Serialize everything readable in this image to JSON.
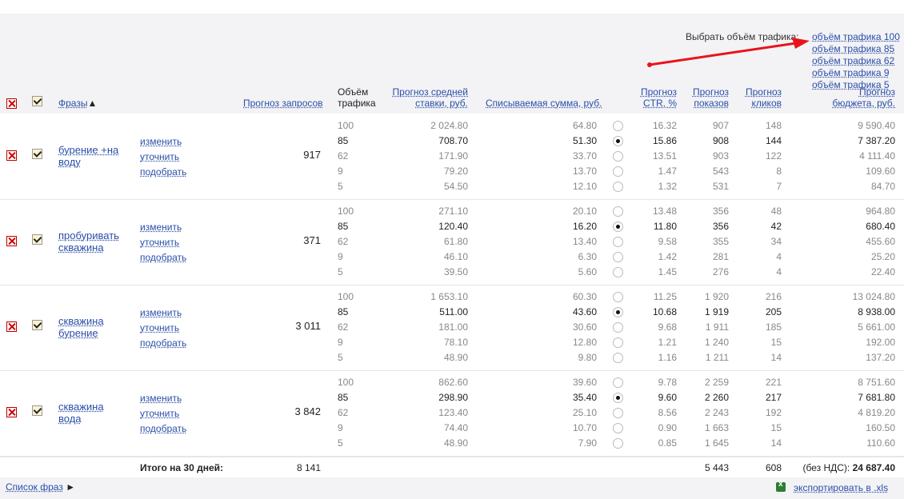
{
  "traffic_selector": {
    "label": "Выбрать объём трафика:",
    "options": [
      "объём трафика 100",
      "объём трафика 85",
      "объём трафика 62",
      "объём трафика 9",
      "объём трафика 5"
    ]
  },
  "columns": {
    "phrases": "Фразы",
    "sort_marker": "▲",
    "forecast_requests": "Прогноз запросов",
    "traffic_volume": [
      "Объём",
      "трафика"
    ],
    "avg_bid": [
      "Прогноз средней",
      "ставки, руб."
    ],
    "charged": "Списываемая сумма, руб.",
    "ctr": [
      "Прогноз",
      "CTR, %"
    ],
    "impressions": [
      "Прогноз",
      "показов"
    ],
    "clicks": [
      "Прогноз",
      "кликов"
    ],
    "budget": [
      "Прогноз",
      "бюджета, руб."
    ]
  },
  "actions": [
    "изменить",
    "уточнить",
    "подобрать"
  ],
  "groups": [
    {
      "phrase": "бурение +на воду",
      "requests": "917",
      "rows": [
        {
          "lvl": "100",
          "bid": "2 024.80",
          "cost": "64.80",
          "ctr": "16.32",
          "imp": "907",
          "clk": "148",
          "bud": "9 590.40",
          "sel": false
        },
        {
          "lvl": "85",
          "bid": "708.70",
          "cost": "51.30",
          "ctr": "15.86",
          "imp": "908",
          "clk": "144",
          "bud": "7 387.20",
          "sel": true
        },
        {
          "lvl": "62",
          "bid": "171.90",
          "cost": "33.70",
          "ctr": "13.51",
          "imp": "903",
          "clk": "122",
          "bud": "4 111.40",
          "sel": false
        },
        {
          "lvl": "9",
          "bid": "79.20",
          "cost": "13.70",
          "ctr": "1.47",
          "imp": "543",
          "clk": "8",
          "bud": "109.60",
          "sel": false
        },
        {
          "lvl": "5",
          "bid": "54.50",
          "cost": "12.10",
          "ctr": "1.32",
          "imp": "531",
          "clk": "7",
          "bud": "84.70",
          "sel": false
        }
      ]
    },
    {
      "phrase": "пробуривать скважина",
      "requests": "371",
      "rows": [
        {
          "lvl": "100",
          "bid": "271.10",
          "cost": "20.10",
          "ctr": "13.48",
          "imp": "356",
          "clk": "48",
          "bud": "964.80",
          "sel": false
        },
        {
          "lvl": "85",
          "bid": "120.40",
          "cost": "16.20",
          "ctr": "11.80",
          "imp": "356",
          "clk": "42",
          "bud": "680.40",
          "sel": true
        },
        {
          "lvl": "62",
          "bid": "61.80",
          "cost": "13.40",
          "ctr": "9.58",
          "imp": "355",
          "clk": "34",
          "bud": "455.60",
          "sel": false
        },
        {
          "lvl": "9",
          "bid": "46.10",
          "cost": "6.30",
          "ctr": "1.42",
          "imp": "281",
          "clk": "4",
          "bud": "25.20",
          "sel": false
        },
        {
          "lvl": "5",
          "bid": "39.50",
          "cost": "5.60",
          "ctr": "1.45",
          "imp": "276",
          "clk": "4",
          "bud": "22.40",
          "sel": false
        }
      ]
    },
    {
      "phrase": "скважина бурение",
      "requests": "3 011",
      "rows": [
        {
          "lvl": "100",
          "bid": "1 653.10",
          "cost": "60.30",
          "ctr": "11.25",
          "imp": "1 920",
          "clk": "216",
          "bud": "13 024.80",
          "sel": false
        },
        {
          "lvl": "85",
          "bid": "511.00",
          "cost": "43.60",
          "ctr": "10.68",
          "imp": "1 919",
          "clk": "205",
          "bud": "8 938.00",
          "sel": true
        },
        {
          "lvl": "62",
          "bid": "181.00",
          "cost": "30.60",
          "ctr": "9.68",
          "imp": "1 911",
          "clk": "185",
          "bud": "5 661.00",
          "sel": false
        },
        {
          "lvl": "9",
          "bid": "78.10",
          "cost": "12.80",
          "ctr": "1.21",
          "imp": "1 240",
          "clk": "15",
          "bud": "192.00",
          "sel": false
        },
        {
          "lvl": "5",
          "bid": "48.90",
          "cost": "9.80",
          "ctr": "1.16",
          "imp": "1 211",
          "clk": "14",
          "bud": "137.20",
          "sel": false
        }
      ]
    },
    {
      "phrase": "скважина вода",
      "requests": "3 842",
      "rows": [
        {
          "lvl": "100",
          "bid": "862.60",
          "cost": "39.60",
          "ctr": "9.78",
          "imp": "2 259",
          "clk": "221",
          "bud": "8 751.60",
          "sel": false
        },
        {
          "lvl": "85",
          "bid": "298.90",
          "cost": "35.40",
          "ctr": "9.60",
          "imp": "2 260",
          "clk": "217",
          "bud": "7 681.80",
          "sel": true
        },
        {
          "lvl": "62",
          "bid": "123.40",
          "cost": "25.10",
          "ctr": "8.56",
          "imp": "2 243",
          "clk": "192",
          "bud": "4 819.20",
          "sel": false
        },
        {
          "lvl": "9",
          "bid": "74.40",
          "cost": "10.70",
          "ctr": "0.90",
          "imp": "1 663",
          "clk": "15",
          "bud": "160.50",
          "sel": false
        },
        {
          "lvl": "5",
          "bid": "48.90",
          "cost": "7.90",
          "ctr": "0.85",
          "imp": "1 645",
          "clk": "14",
          "bud": "110.60",
          "sel": false
        }
      ]
    }
  ],
  "totals": {
    "label": "Итого на 30 дней:",
    "requests": "8 141",
    "impressions": "5 443",
    "clicks": "608",
    "budget_prefix": "(без НДС):",
    "budget": "24 687.40"
  },
  "footer": {
    "phrase_list": "Список фраз",
    "phrase_list_arrow": "►",
    "export": "экспортировать в .xls"
  }
}
